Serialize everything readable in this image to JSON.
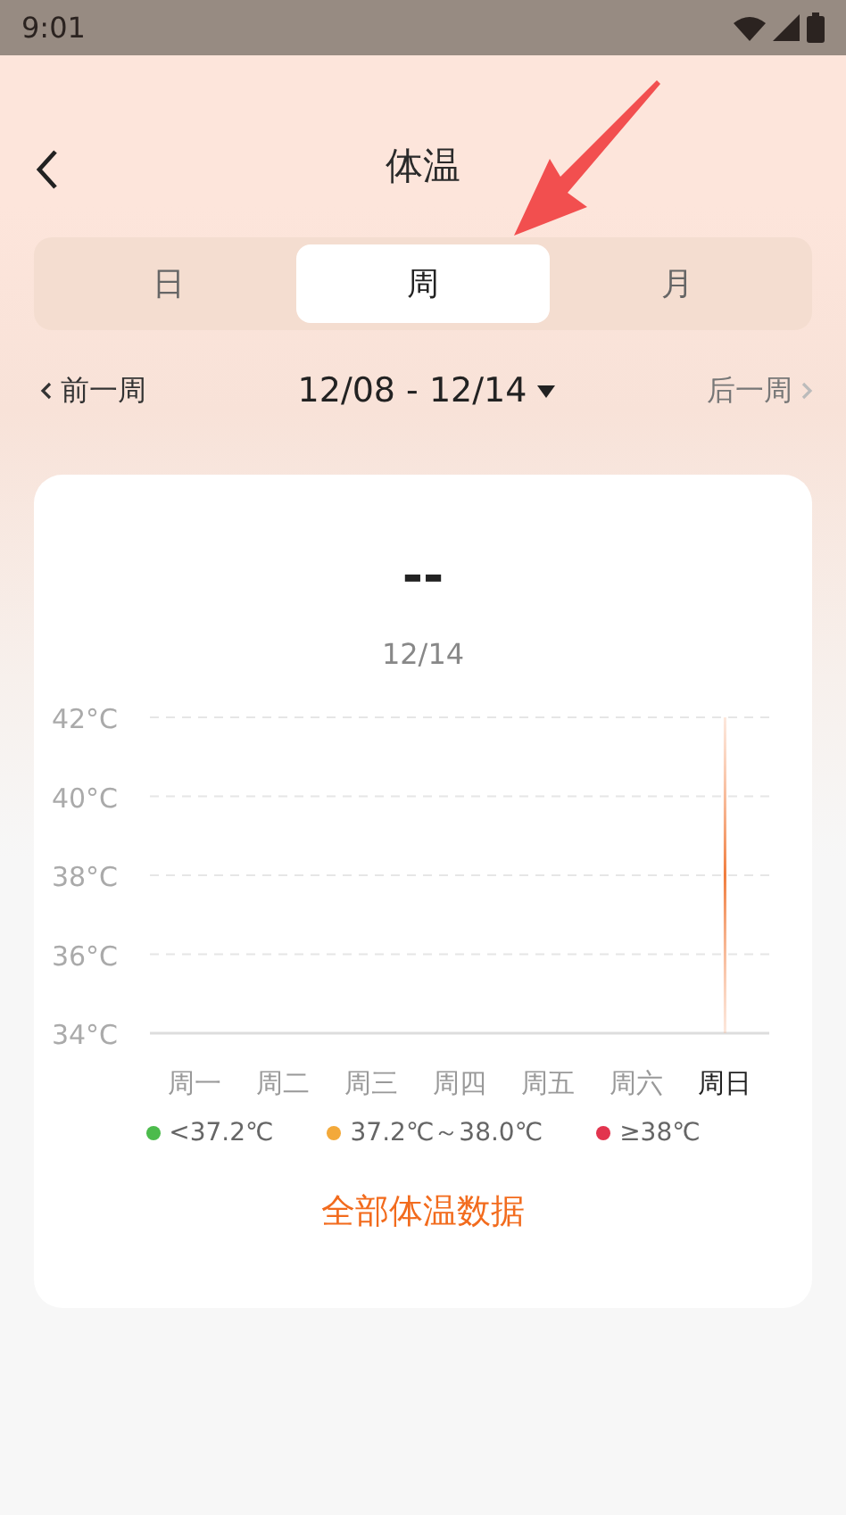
{
  "status_bar": {
    "time": "9:01"
  },
  "header": {
    "title": "体温"
  },
  "tabs": [
    {
      "label": "日",
      "selected": false
    },
    {
      "label": "周",
      "selected": true
    },
    {
      "label": "月",
      "selected": false
    }
  ],
  "week_nav": {
    "previous": "前一周",
    "range": "12/08 - 12/14",
    "next": "后一周"
  },
  "summary": {
    "value": "--",
    "date": "12/14"
  },
  "chart": {
    "chart_data": {
      "type": "line",
      "grid": true,
      "ref_lines": [
        {
          "axis": "x",
          "value": "周日"
        }
      ],
      "categories": [
        "周一",
        "周二",
        "周三",
        "周四",
        "周五",
        "周六",
        "周日"
      ],
      "ylim": [
        34,
        42
      ],
      "yticks": [
        {
          "value": 42,
          "label": "42°C"
        },
        {
          "value": 40,
          "label": "40°C"
        },
        {
          "value": 38,
          "label": "38°C"
        },
        {
          "value": 36,
          "label": "36°C"
        },
        {
          "value": 34,
          "label": "34°C"
        }
      ]
    },
    "day_selected": [
      false,
      false,
      false,
      false,
      false,
      false,
      true
    ]
  },
  "legend": [
    {
      "label": "<37.2℃",
      "color": "#4cbb4c"
    },
    {
      "label": "37.2℃～38.0℃",
      "color": "#f3a93a"
    },
    {
      "label": "≥38℃",
      "color": "#e2344e"
    }
  ],
  "all_data_link": "全部体温数据"
}
